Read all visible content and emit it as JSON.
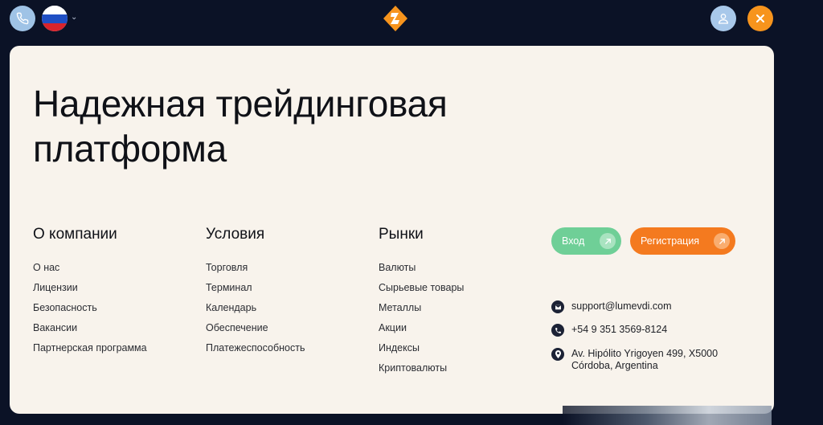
{
  "header": {
    "language_flag": "russia-flag",
    "colors": {
      "accent": "#f7941d",
      "background": "#0b1226"
    }
  },
  "hero": {
    "title": "Надежная трейдинговая платформа"
  },
  "columns": [
    {
      "title": "О компании",
      "items": [
        "О нас",
        "Лицензии",
        "Безопасность",
        "Вакансии",
        "Партнерская программа"
      ]
    },
    {
      "title": "Условия",
      "items": [
        "Торговля",
        "Терминал",
        "Календарь",
        "Обеспечение",
        "Платежеспособность"
      ]
    },
    {
      "title": "Рынки",
      "items": [
        "Валюты",
        "Сырьевые товары",
        "Металлы",
        "Акции",
        "Индексы",
        "Криптовалюты"
      ]
    }
  ],
  "auth": {
    "login_label": "Вход",
    "register_label": "Регистрация",
    "colors": {
      "login": "#6fcf97",
      "register": "#f47a1f"
    }
  },
  "contacts": {
    "email": "support@lumevdi.com",
    "phone": "+54 9 351 3569-8124",
    "address": "Av. Hipólito Yrigoyen 499, X5000 Córdoba, Argentina"
  }
}
